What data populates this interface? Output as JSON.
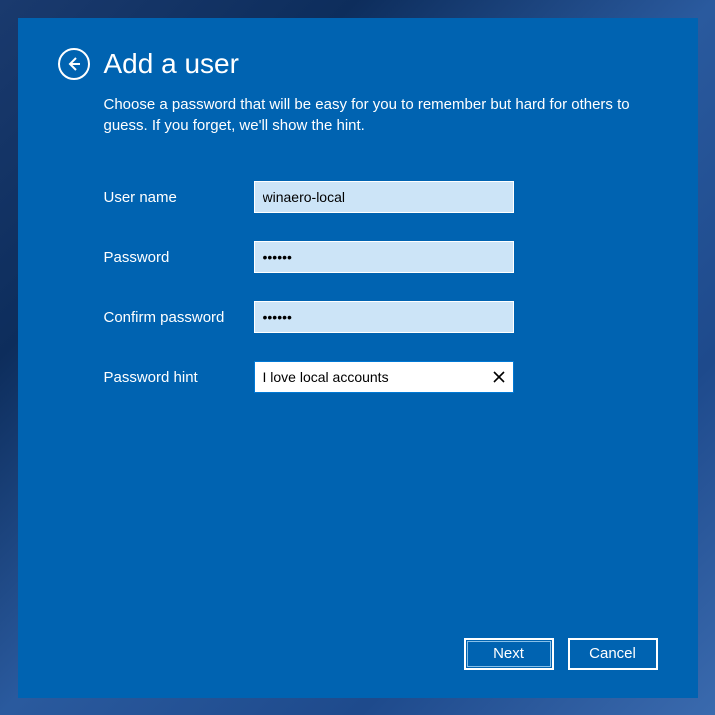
{
  "dialog": {
    "title": "Add a user",
    "subtitle": "Choose a password that will be easy for you to remember but hard for others to guess. If you forget, we'll show the hint."
  },
  "form": {
    "username_label": "User name",
    "username_value": "winaero-local",
    "password_label": "Password",
    "password_value": "••••••",
    "confirm_label": "Confirm password",
    "confirm_value": "••••••",
    "hint_label": "Password hint",
    "hint_value": "I love local accounts"
  },
  "buttons": {
    "next": "Next",
    "cancel": "Cancel"
  }
}
